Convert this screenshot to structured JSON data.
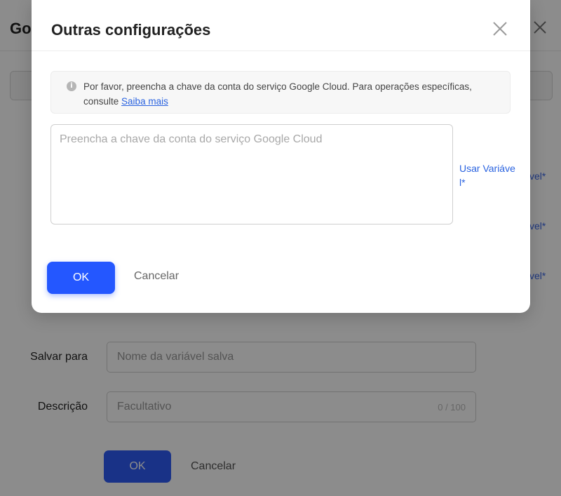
{
  "background": {
    "title": "Go",
    "variable_links": [
      "vel*",
      "vel*",
      "vel*"
    ],
    "form": {
      "save_to_label": "Salvar para",
      "save_to_placeholder": "Nome da variável salva",
      "description_label": "Descrição",
      "description_placeholder": "Facultativo",
      "description_counter": "0 / 100"
    },
    "ok_label": "OK",
    "cancel_label": "Cancelar"
  },
  "modal": {
    "title": "Outras configurações",
    "close_icon": "close-icon",
    "info": {
      "icon": "info-icon",
      "text": "Por favor, preencha a chave da conta do serviço Google Cloud. Para operações específicas, consulte ",
      "link": "Saiba mais"
    },
    "key_input": {
      "placeholder": "Preencha a chave da conta do serviço Google Cloud",
      "value": ""
    },
    "use_variable_link": "Usar Variável*",
    "ok_label": "OK",
    "cancel_label": "Cancelar"
  },
  "colors": {
    "primary": "#2457ff",
    "link": "#2a63e0",
    "overlay": "rgba(0,0,0,0.45)"
  }
}
